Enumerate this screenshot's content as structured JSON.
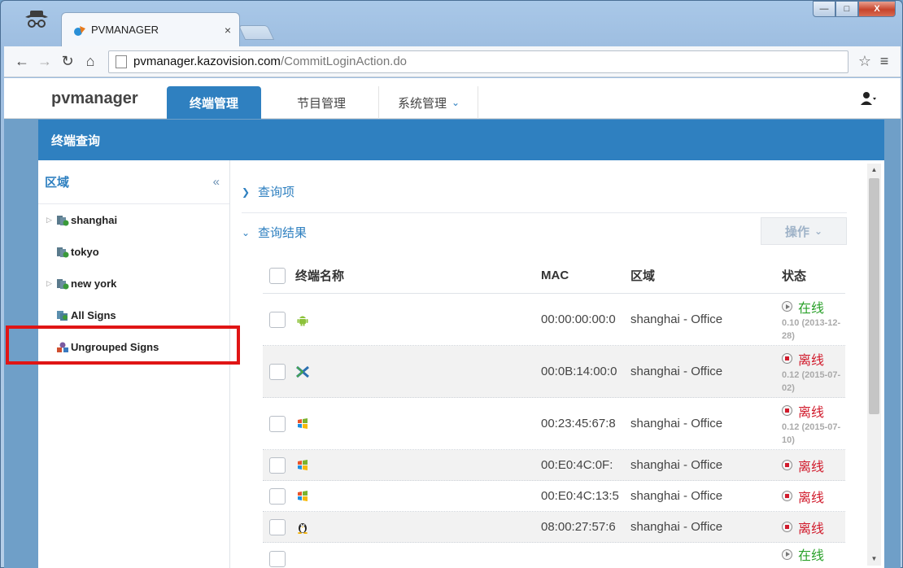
{
  "browser": {
    "tab_title": "PVMANAGER",
    "tab_close": "×",
    "url_host": "pvmanager.kazovision.com",
    "url_path": "/CommitLoginAction.do",
    "win_min": "—",
    "win_max": "□",
    "win_close": "X"
  },
  "app": {
    "brand": "pvmanager",
    "nav": [
      {
        "label": "终端管理"
      },
      {
        "label": "节目管理"
      },
      {
        "label": "系统管理"
      }
    ],
    "panel_title": "终端查询"
  },
  "sidebar": {
    "title": "区域",
    "collapse": "«",
    "items": [
      {
        "label": "shanghai",
        "icon": "group-icon"
      },
      {
        "label": "tokyo",
        "icon": "group-icon"
      },
      {
        "label": "new york",
        "icon": "group-icon"
      },
      {
        "label": "All Signs",
        "icon": "all-signs-icon"
      },
      {
        "label": "Ungrouped Signs",
        "icon": "ungrouped-icon"
      }
    ]
  },
  "main": {
    "query_section": "查询项",
    "result_section": "查询结果",
    "op_button": "操作",
    "columns": {
      "name": "终端名称",
      "mac": "MAC",
      "region": "区域",
      "status": "状态"
    },
    "rows": [
      {
        "os": "android-icon",
        "mac": "00:00:00:00:0",
        "region": "shanghai - Office",
        "status": "在线",
        "online": true,
        "ver": "0.10 (2013-12-28)"
      },
      {
        "os": "x-icon",
        "mac": "00:0B:14:00:0",
        "region": "shanghai - Office",
        "status": "离线",
        "online": false,
        "ver": "0.12 (2015-07-02)"
      },
      {
        "os": "windows-icon",
        "mac": "00:23:45:67:8",
        "region": "shanghai - Office",
        "status": "离线",
        "online": false,
        "ver": "0.12 (2015-07-10)"
      },
      {
        "os": "windows-icon",
        "mac": "00:E0:4C:0F:",
        "region": "shanghai - Office",
        "status": "离线",
        "online": false,
        "ver": ""
      },
      {
        "os": "windows-icon",
        "mac": "00:E0:4C:13:5",
        "region": "shanghai - Office",
        "status": "离线",
        "online": false,
        "ver": ""
      },
      {
        "os": "linux-icon",
        "mac": "08:00:27:57:6",
        "region": "shanghai - Office",
        "status": "离线",
        "online": false,
        "ver": ""
      },
      {
        "os": "",
        "mac": "",
        "region": "",
        "status": "在线",
        "online": true,
        "ver": ""
      }
    ]
  },
  "colors": {
    "accent": "#2f80c0",
    "online": "#2aa12a",
    "offline": "#d11b2c",
    "highlight": "#e01515"
  }
}
